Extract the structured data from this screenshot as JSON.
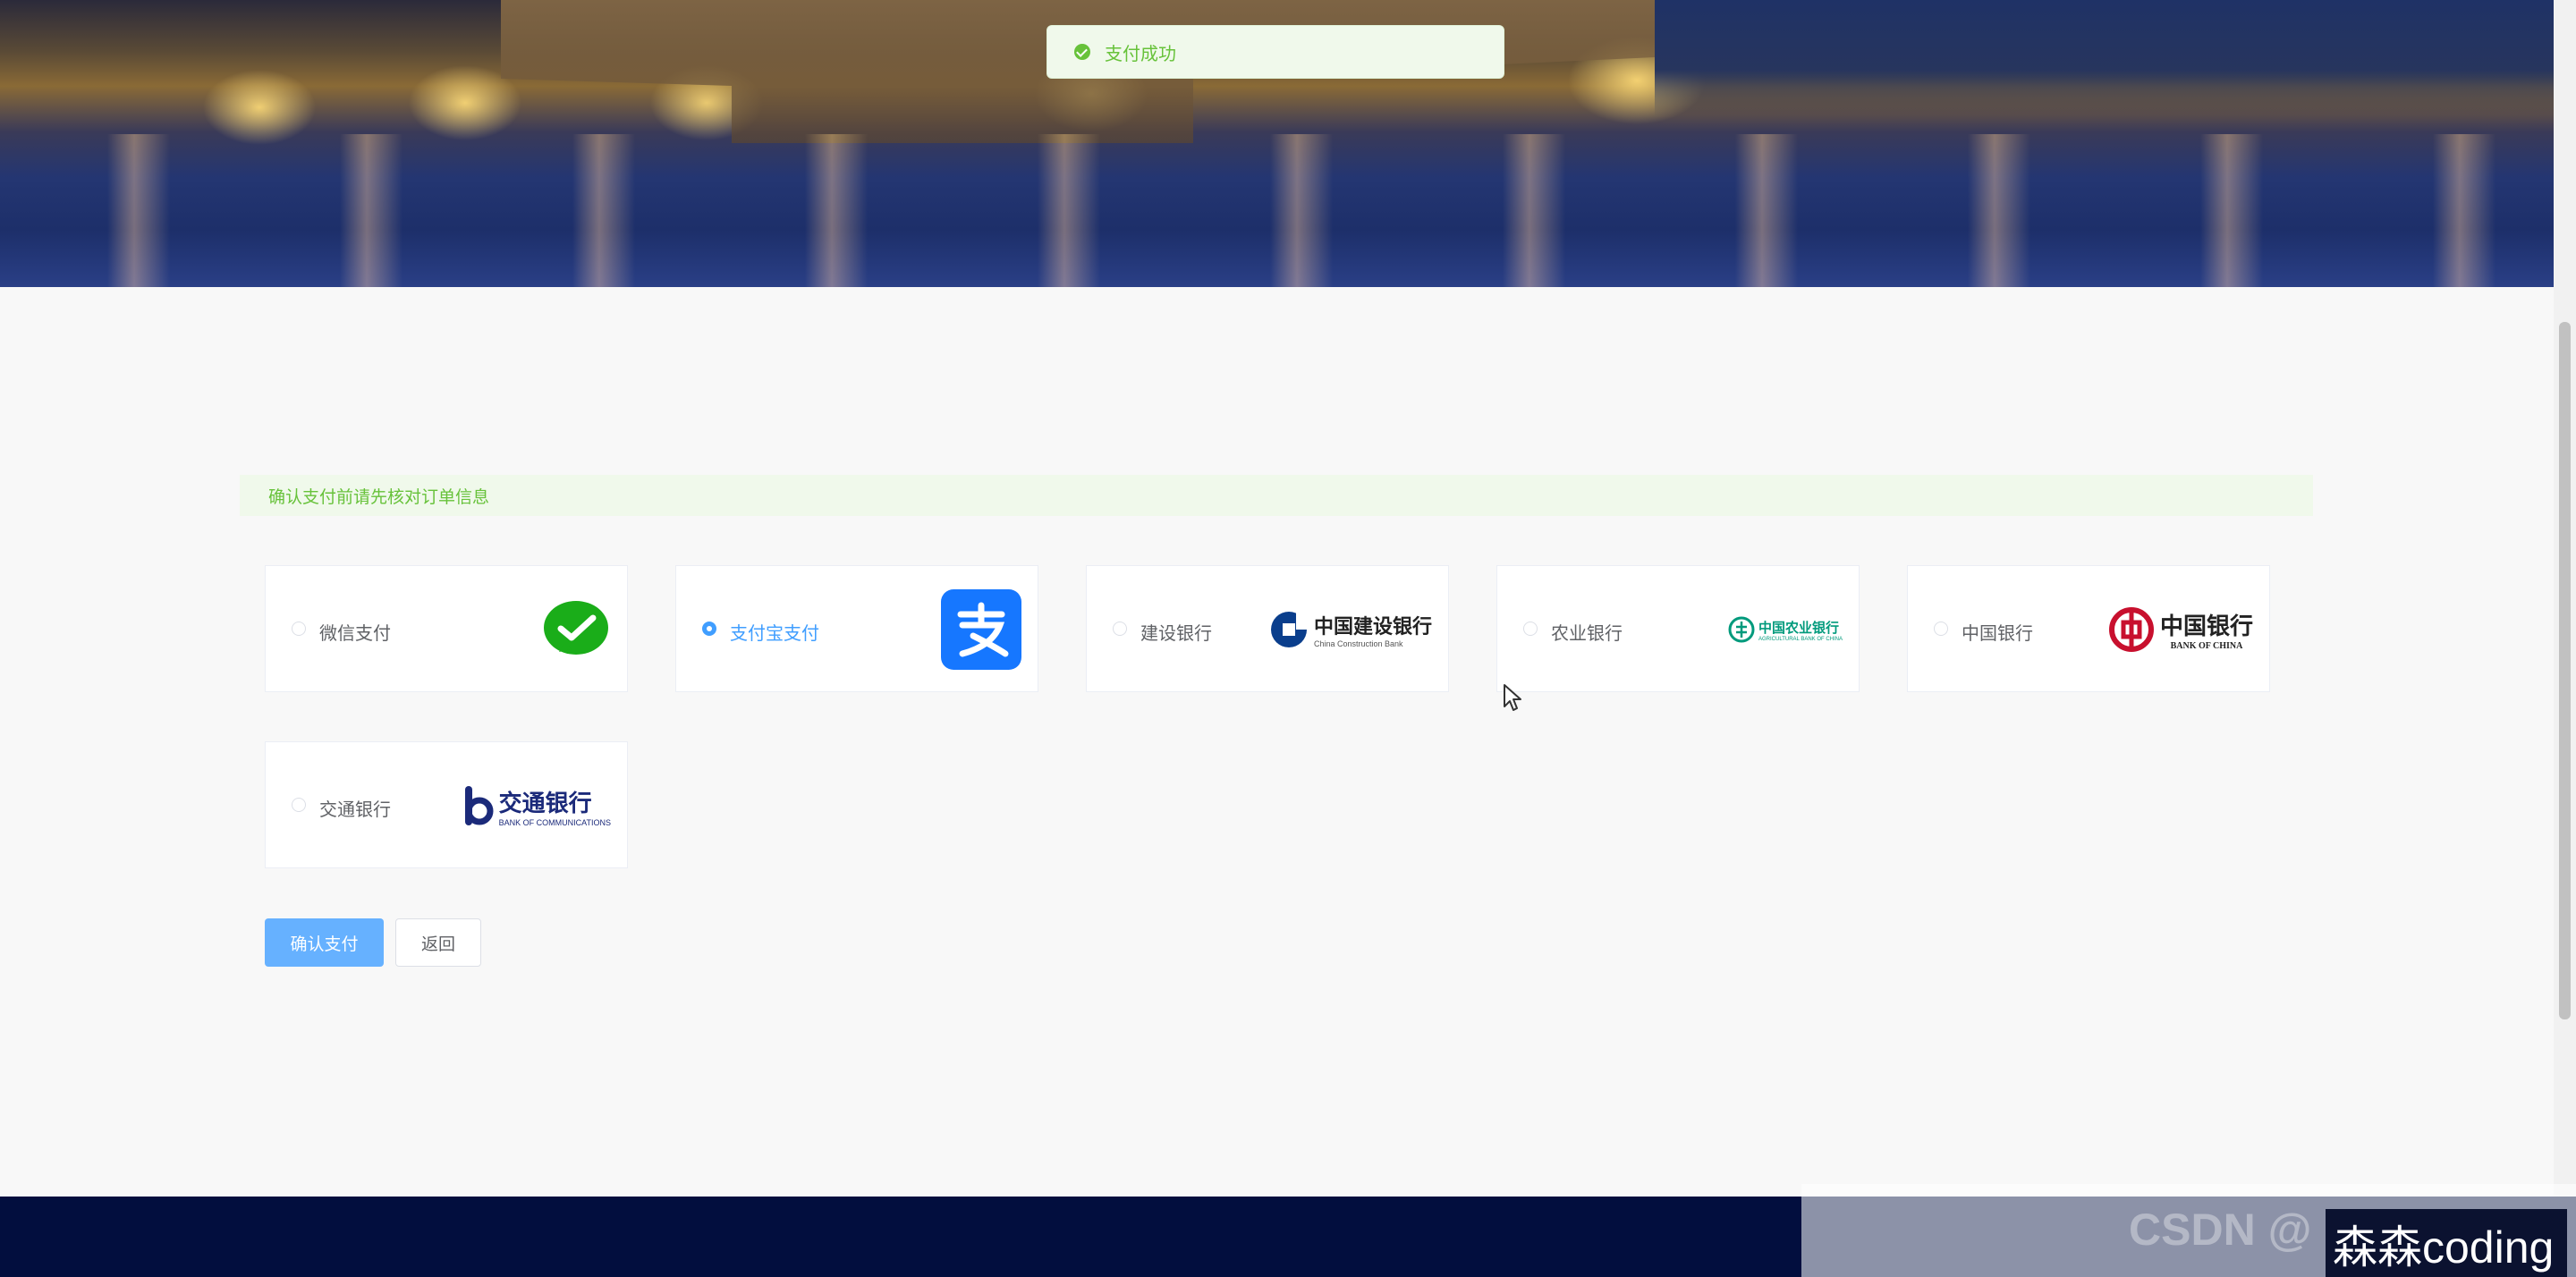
{
  "toast": {
    "message": "支付成功",
    "color": "#67c23a"
  },
  "notice": {
    "text": "确认支付前请先核对订单信息"
  },
  "payment_methods": [
    {
      "label": "微信支付",
      "icon": "wechat-pay-icon",
      "selected": false
    },
    {
      "label": "支付宝支付",
      "icon": "alipay-icon",
      "selected": true
    },
    {
      "label": "建设银行",
      "icon": "ccb-logo",
      "logo_text": "中国建设银行",
      "logo_sub": "China Construction Bank",
      "selected": false
    },
    {
      "label": "农业银行",
      "icon": "abc-logo",
      "logo_text": "中国农业银行",
      "logo_sub": "AGRICULTURAL BANK OF CHINA",
      "selected": false
    },
    {
      "label": "中国银行",
      "icon": "boc-logo",
      "logo_text": "中国银行",
      "logo_sub": "BANK OF CHINA",
      "selected": false
    },
    {
      "label": "交通银行",
      "icon": "bocom-logo",
      "logo_text": "交通银行",
      "logo_sub": "BANK OF COMMUNICATIONS",
      "selected": false
    }
  ],
  "actions": {
    "confirm_label": "确认支付",
    "back_label": "返回"
  },
  "colors": {
    "primary": "#409eff",
    "success": "#67c23a",
    "footer": "#020e3e"
  },
  "watermark": {
    "text": "森森coding",
    "faint": "CSDN @"
  }
}
